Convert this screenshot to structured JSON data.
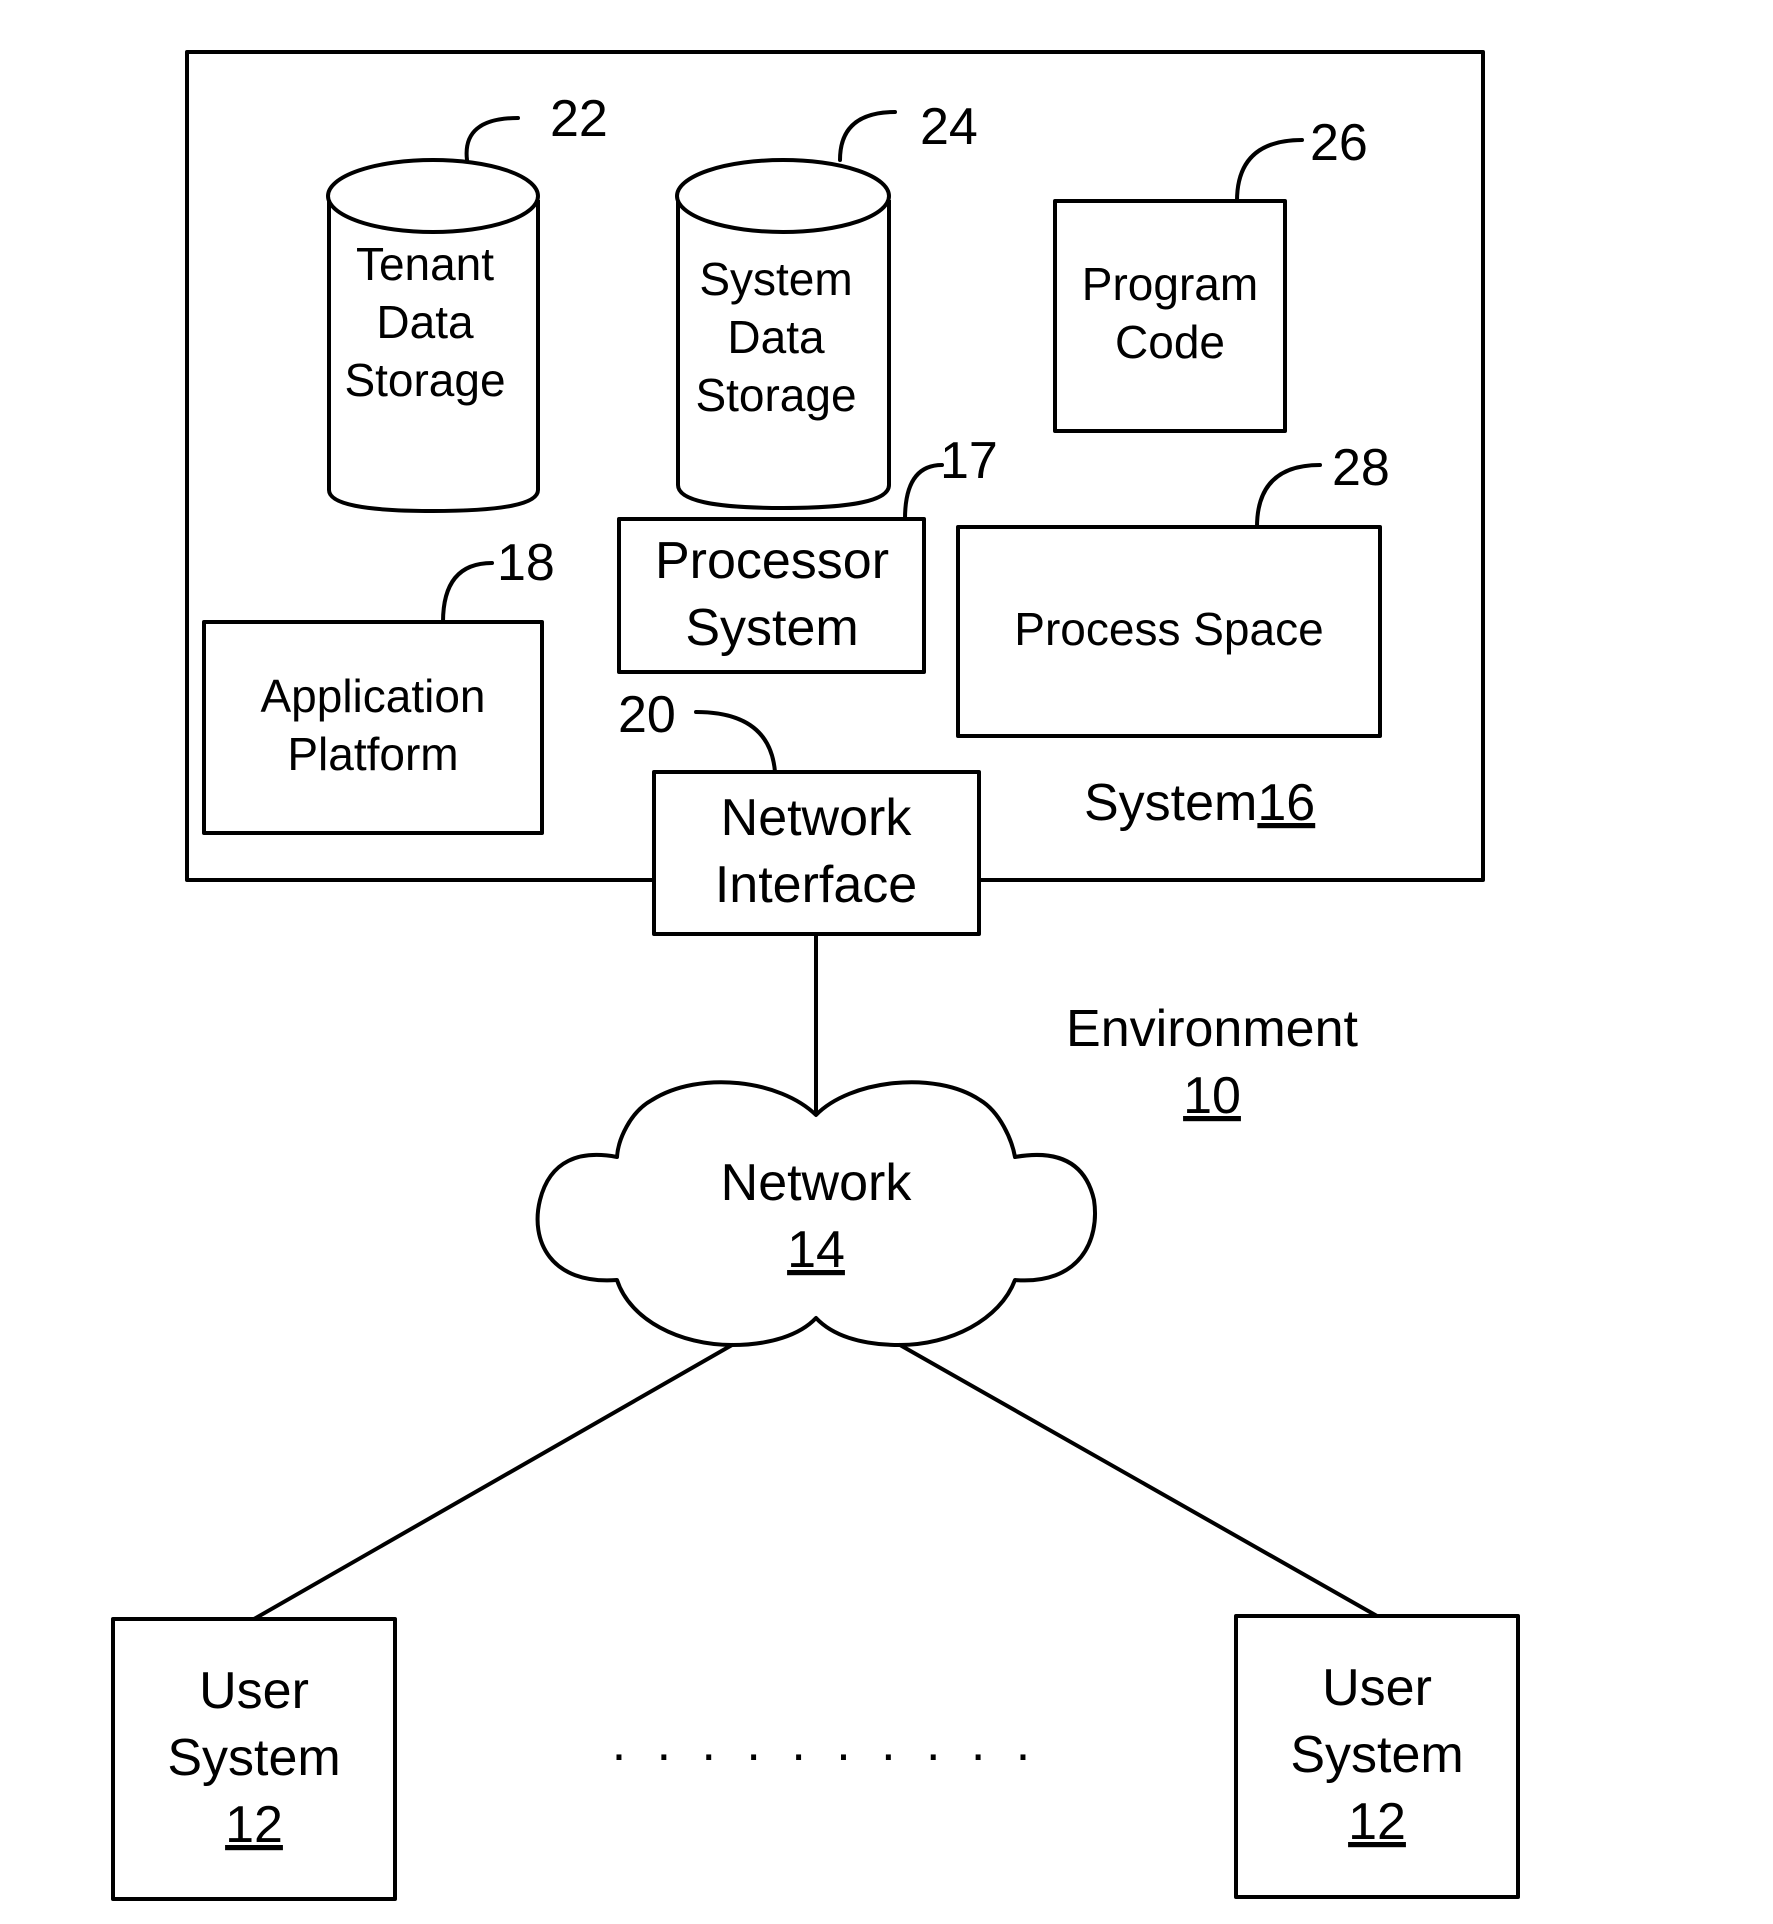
{
  "diagram": {
    "title": "Environment",
    "title_ref": "10",
    "system": {
      "label": "System",
      "ref": "16",
      "components": {
        "tenant_data_storage": {
          "lines": [
            "Tenant",
            "Data",
            "Storage"
          ],
          "ref": "22"
        },
        "system_data_storage": {
          "lines": [
            "System",
            "Data",
            "Storage"
          ],
          "ref": "24"
        },
        "program_code": {
          "lines": [
            "Program",
            "Code"
          ],
          "ref": "26"
        },
        "processor_system": {
          "lines": [
            "Processor",
            "System"
          ],
          "ref": "17"
        },
        "process_space": {
          "lines": [
            "Process Space"
          ],
          "ref": "28"
        },
        "application_platform": {
          "lines": [
            "Application",
            "Platform"
          ],
          "ref": "18"
        },
        "network_interface": {
          "lines": [
            "Network",
            "Interface"
          ],
          "ref": "20"
        }
      }
    },
    "network": {
      "label": "Network",
      "ref": "14"
    },
    "user_systems": [
      {
        "lines": [
          "User",
          "System"
        ],
        "ref": "12"
      },
      {
        "lines": [
          "User",
          "System"
        ],
        "ref": "12"
      }
    ],
    "ellipsis": ". . . . . . . . . ."
  }
}
